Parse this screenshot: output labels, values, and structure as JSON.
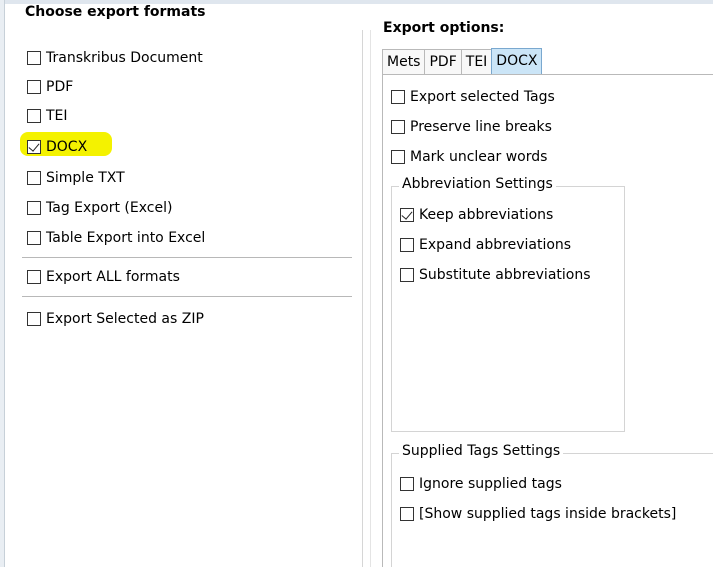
{
  "left_panel": {
    "header": "Choose export formats",
    "formats": [
      {
        "label": "Transkribus Document",
        "checked": false
      },
      {
        "label": "PDF",
        "checked": false
      },
      {
        "label": "TEI",
        "checked": false
      },
      {
        "label": "DOCX",
        "checked": true,
        "highlighted": true
      },
      {
        "label": "Simple TXT",
        "checked": false
      },
      {
        "label": "Tag Export (Excel)",
        "checked": false
      },
      {
        "label": "Table Export into Excel",
        "checked": false
      }
    ],
    "export_all": {
      "label": "Export ALL formats",
      "checked": false
    },
    "export_zip": {
      "label": "Export Selected as ZIP",
      "checked": false
    },
    "highlight_color": "#f4f200"
  },
  "right_panel": {
    "header": "Export options:",
    "tabs": [
      {
        "label": "Mets",
        "active": false
      },
      {
        "label": "PDF",
        "active": false
      },
      {
        "label": "TEI",
        "active": false
      },
      {
        "label": "DOCX",
        "active": true
      }
    ],
    "options": [
      {
        "label": "Export selected Tags",
        "checked": false
      },
      {
        "label": "Preserve line breaks",
        "checked": false
      },
      {
        "label": "Mark unclear words",
        "checked": false
      }
    ],
    "abbreviation_group": {
      "title": "Abbreviation Settings",
      "options": [
        {
          "label": "Keep abbreviations",
          "checked": true
        },
        {
          "label": "Expand abbreviations",
          "checked": false
        },
        {
          "label": "Substitute abbreviations",
          "checked": false
        }
      ]
    },
    "supplied_group": {
      "title": "Supplied Tags Settings",
      "options": [
        {
          "label": "Ignore supplied tags",
          "checked": false
        },
        {
          "label": "[Show supplied tags inside brackets]",
          "checked": false
        }
      ]
    },
    "active_tab_color": "#cbe5f7"
  }
}
